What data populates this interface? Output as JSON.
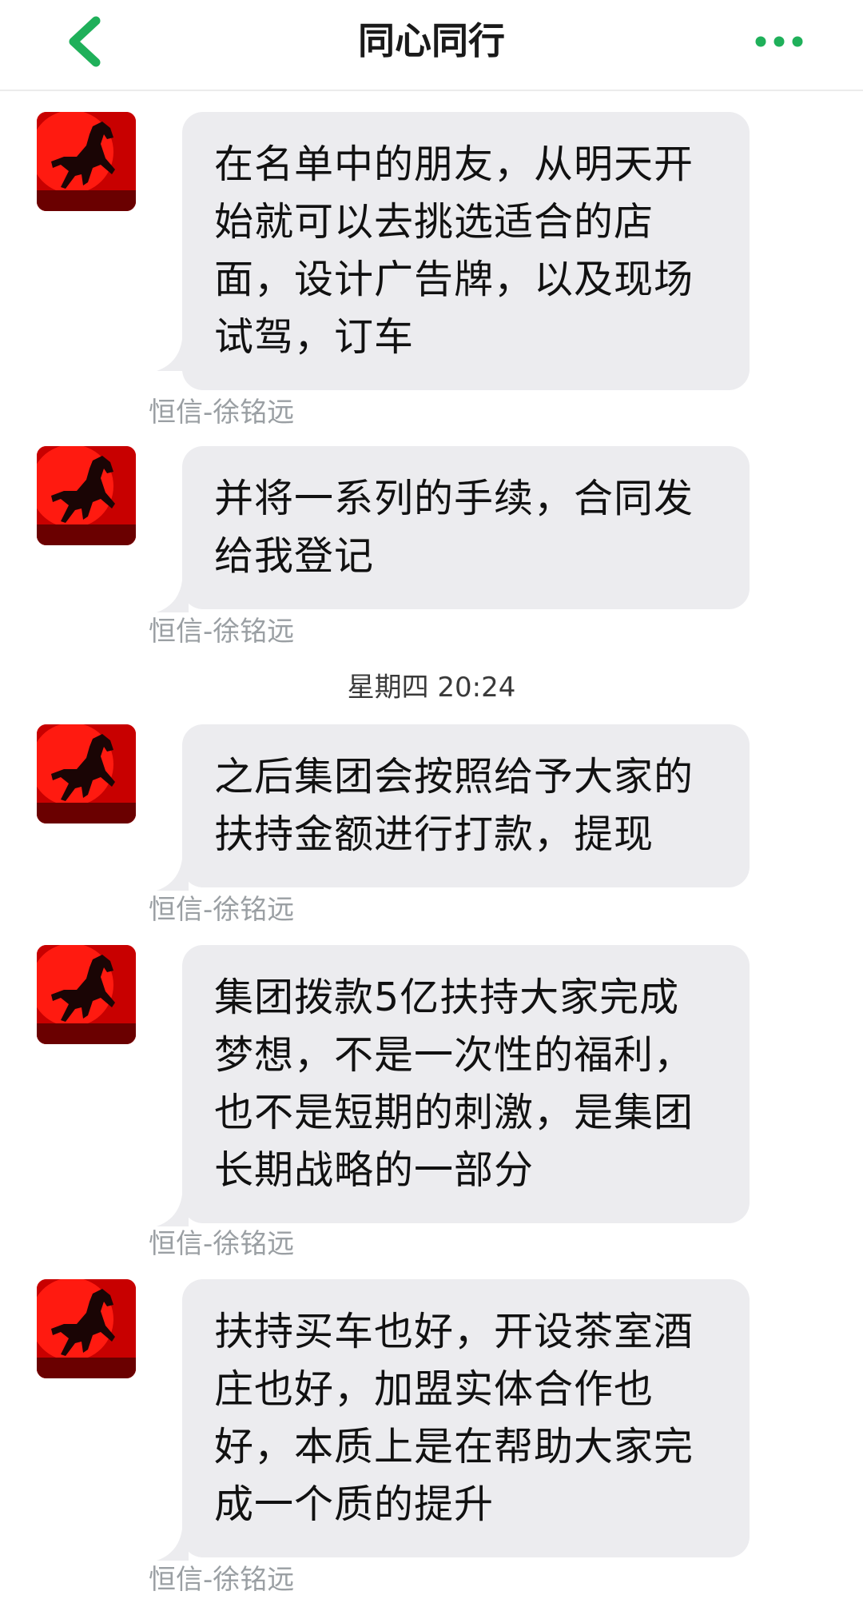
{
  "header": {
    "title": "同心同行",
    "back_icon": "chevron-left-icon",
    "more_icon": "more-dots-icon",
    "accent_color": "#1fb05a"
  },
  "messages": [
    {
      "sender": "恒信-徐铭远",
      "text": "在名单中的朋友，从明天开始就可以去挑选适合的店面，设计广告牌，以及现场试驾，订车"
    },
    {
      "sender": "恒信-徐铭远",
      "text": "并将一系列的手续，合同发给我登记"
    },
    {
      "sender": "恒信-徐铭远",
      "text": "之后集团会按照给予大家的扶持金额进行打款，提现"
    },
    {
      "sender": "恒信-徐铭远",
      "text": "集团拨款5亿扶持大家完成梦想，不是一次性的福利，也不是短期的刺激，是集团长期战略的一部分"
    },
    {
      "sender": "恒信-徐铭远",
      "text": "扶持买车也好，开设茶室酒庄也好，加盟实体合作也好，本质上是在帮助大家完成一个质的提升"
    }
  ],
  "timestamp": "星期四 20:24",
  "avatar_icon": "horse-avatar-icon"
}
